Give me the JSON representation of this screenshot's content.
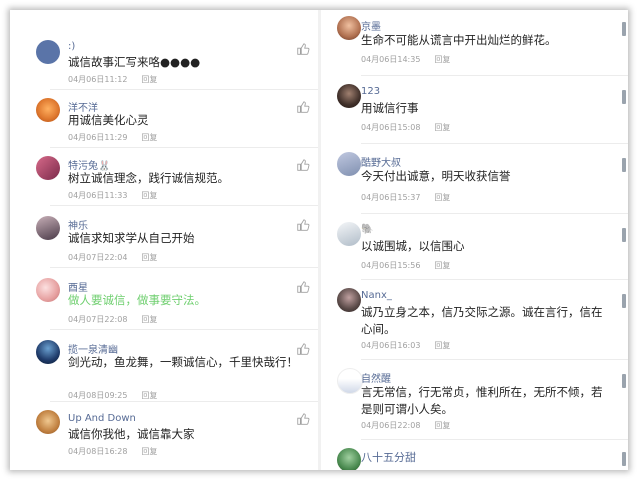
{
  "left_comments": [
    {
      "name": ":)",
      "text": "诚信故事汇写来咯●●●●",
      "date": "04月06日11:12",
      "reply": "回复",
      "avatar_color": "#5a74a8"
    },
    {
      "name": "洋不洋",
      "text": "用诚信美化心灵",
      "date": "04月06日11:29",
      "reply": "回复",
      "avatar_color": "#e07a30"
    },
    {
      "name": "特污兔🐰",
      "text": "树立诚信理念，践行诚信规范。",
      "date": "04月06日11:33",
      "reply": "回复",
      "avatar_color": "#b04a6a"
    },
    {
      "name": "神乐",
      "text": "诚信求知求学从自己开始",
      "date": "04月07日22:04",
      "reply": "回复",
      "avatar_color": "#6a5a70"
    },
    {
      "name": "酉星",
      "text": "做人要诚信，做事要守法。",
      "date": "04月07日22:08",
      "reply": "回复",
      "avatar_color": "#e6a0a0",
      "green": true
    },
    {
      "name": "揽一泉清幽",
      "text": "剑光动，鱼龙舞，一颗诚信心，千里快哉行！",
      "date": "04月08日09:25",
      "reply": "回复",
      "avatar_color": "#1f3b6a"
    },
    {
      "name": "Up And Down",
      "text": "诚信你我他，诚信靠大家",
      "date": "04月08日16:28",
      "reply": "回复",
      "avatar_color": "#c08040"
    }
  ],
  "right_comments": [
    {
      "name": "京墨",
      "text": "生命不可能从谎言中开出灿烂的鲜花。",
      "date": "04月06日14:35",
      "reply": "回复",
      "avatar_color": "#b07050"
    },
    {
      "name": "123",
      "text": "用诚信行事",
      "date": "04月06日15:08",
      "reply": "回复",
      "avatar_color": "#40302a"
    },
    {
      "name": "酷野大叔",
      "text": "今天付出诚意，明天收获信誉",
      "date": "04月06日15:37",
      "reply": "回复",
      "avatar_color": "#8090b0"
    },
    {
      "name": "🐘",
      "text": "以诚围城，以信围心",
      "date": "04月06日15:56",
      "reply": "回复",
      "avatar_color": "#d0d8e0"
    },
    {
      "name": "Nanx_",
      "text": "诚乃立身之本，信乃交际之源。诚在言行，信在心间。",
      "date": "04月06日16:03",
      "reply": "回复",
      "avatar_color": "#5a4a48"
    },
    {
      "name": "自然醒",
      "text": "言无常信，行无常贞，惟利所在，无所不倾，若是则可谓小人矣。",
      "date": "04月06日22:08",
      "reply": "回复",
      "avatar_color": "#e8e8e8"
    },
    {
      "name": "八十五分甜",
      "avatar_color": "#4a8a50"
    }
  ]
}
